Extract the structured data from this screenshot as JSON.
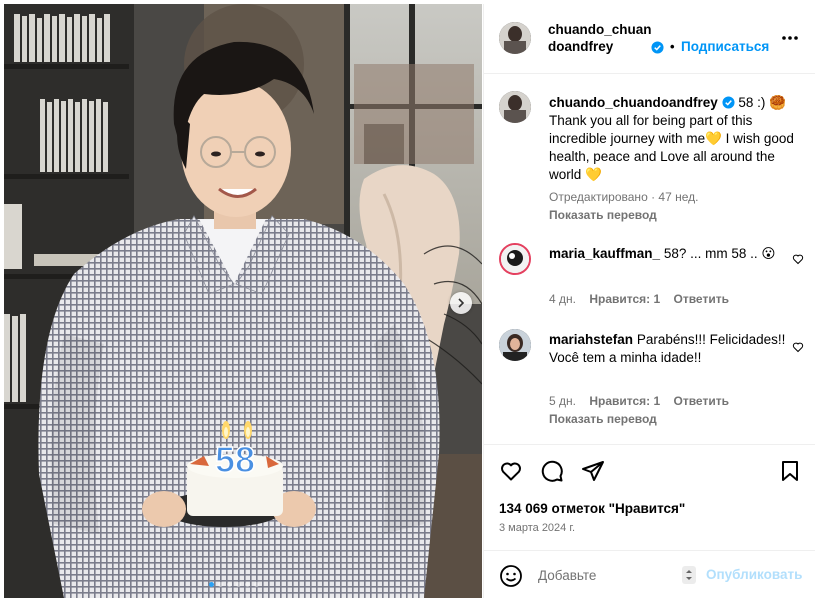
{
  "post": {
    "author_line1": "chuando_chuan",
    "author_line2": "doandfrey",
    "separator": "•",
    "follow_label": "Подписаться",
    "more_icon": "more-options-icon"
  },
  "caption": {
    "username": "chuando_chuandoandfrey",
    "text": "58 :) 🥮 Thank you all for being part of this incredible journey with me💛 I wish good health, peace and Love all around the world 💛",
    "edited": "Отредактировано · 47 нед.",
    "translate": "Показать перевод"
  },
  "comments": [
    {
      "username": "maria_kauffman_",
      "text": "58? ... mm 58 .. 😮",
      "time": "4 дн.",
      "likes": "Нравится: 1",
      "reply": "Ответить"
    },
    {
      "username": "mariahstefan",
      "text": "Parabéns!!! Felicidades!! Você tem a minha idade!!",
      "time": "5 дн.",
      "likes": "Нравится: 1",
      "reply": "Ответить",
      "translate": "Показать перевод"
    }
  ],
  "stats": {
    "likes": "134 069 отметок \"Нравится\"",
    "date": "3 марта 2024 г."
  },
  "composer": {
    "placeholder": "Добавьте",
    "publish_label": "Опубликовать"
  },
  "carousel": {
    "slide_count": 6,
    "active_index": 0
  },
  "photo": {
    "cake_number": "58"
  },
  "colors": {
    "accent": "#0095f6",
    "publish_disabled": "#b2dffc",
    "muted_text": "#737373",
    "divider": "#efefef",
    "verified": "#0095f6"
  }
}
